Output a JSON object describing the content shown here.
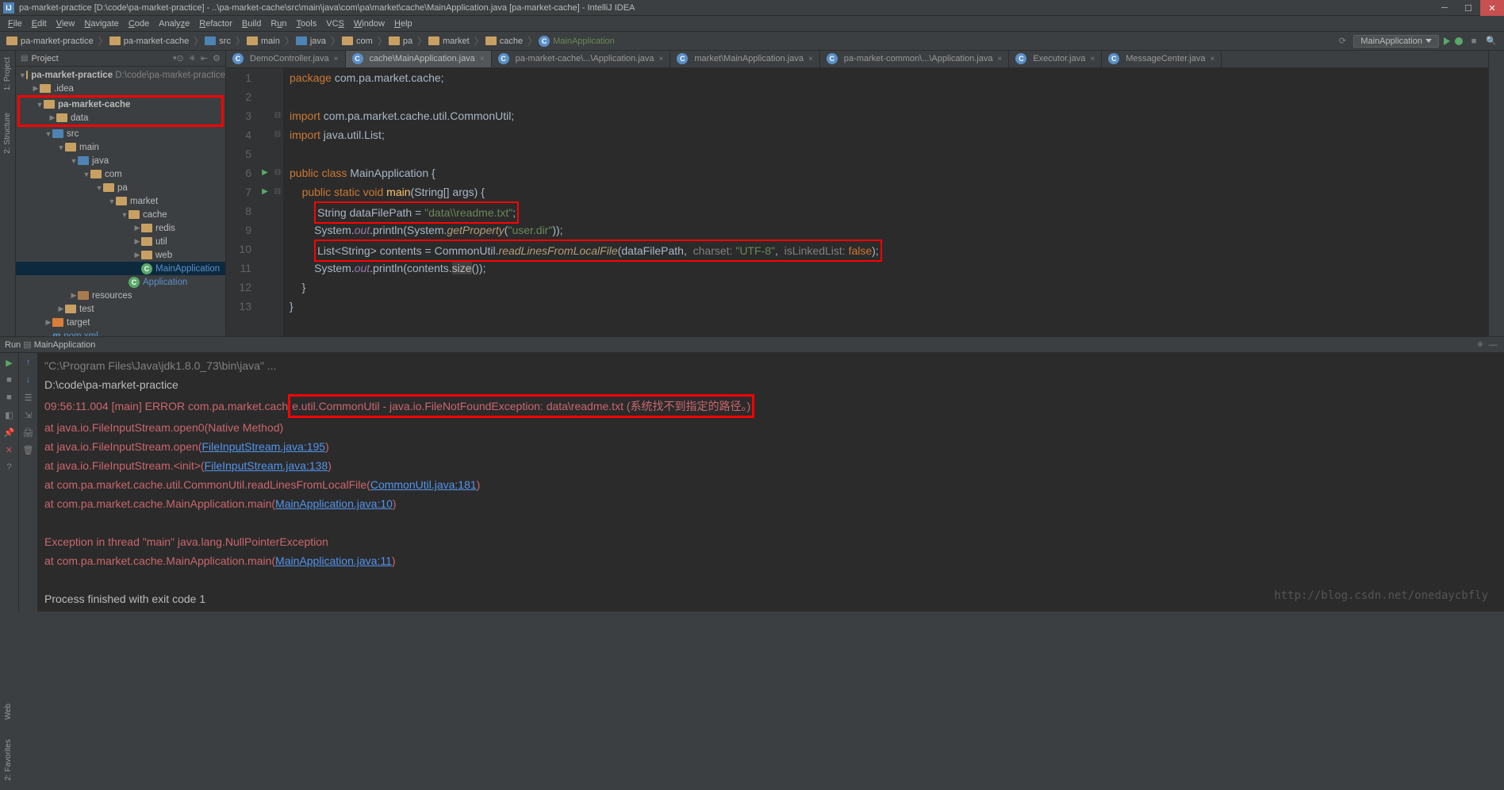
{
  "titlebar": {
    "text": "pa-market-practice [D:\\code\\pa-market-practice] - ..\\pa-market-cache\\src\\main\\java\\com\\pa\\market\\cache\\MainApplication.java [pa-market-cache] - IntelliJ IDEA"
  },
  "menu": [
    "File",
    "Edit",
    "View",
    "Navigate",
    "Code",
    "Analyze",
    "Refactor",
    "Build",
    "Run",
    "Tools",
    "VCS",
    "Window",
    "Help"
  ],
  "breadcrumb": [
    "pa-market-practice",
    "pa-market-cache",
    "src",
    "main",
    "java",
    "com",
    "pa",
    "market",
    "cache",
    "MainApplication"
  ],
  "run_config": "MainApplication",
  "left_tabs": [
    "1: Project",
    "2: Structure"
  ],
  "right_tabs": [],
  "project_panel": {
    "title": "Project"
  },
  "tree": {
    "root": {
      "label": "pa-market-practice",
      "path": "D:\\code\\pa-market-practice"
    },
    "idea": ".idea",
    "cache_mod": "pa-market-cache",
    "data": "data",
    "src": "src",
    "main": "main",
    "java": "java",
    "com": "com",
    "pa": "pa",
    "market": "market",
    "cache": "cache",
    "redis": "redis",
    "util": "util",
    "web": "web",
    "main_app": "MainApplication",
    "application": "Application",
    "resources": "resources",
    "test": "test",
    "target": "target",
    "pom": "pom.xml"
  },
  "editor_tabs": [
    {
      "label": "DemoController.java",
      "active": false
    },
    {
      "label": "cache\\MainApplication.java",
      "active": true
    },
    {
      "label": "pa-market-cache\\...\\Application.java",
      "active": false
    },
    {
      "label": "market\\MainApplication.java",
      "active": false
    },
    {
      "label": "pa-market-common\\...\\Application.java",
      "active": false
    },
    {
      "label": "Executor.java",
      "active": false
    },
    {
      "label": "MessageCenter.java",
      "active": false
    }
  ],
  "code": {
    "line_count": 13,
    "package": "package com.pa.market.cache;",
    "import1": "import com.pa.market.cache.util.CommonUtil;",
    "import2": "import java.util.List;",
    "l8_a": "String dataFilePath = ",
    "l8_b": "\"data\\\\readme.txt\"",
    "l8_c": ";",
    "l9": "System.out.println(System.getProperty(\"user.dir\"));",
    "l10_a": "List<String> contents = CommonUtil.",
    "l10_fn": "readLinesFromLocalFile",
    "l10_b": "(dataFilePath,  charset: ",
    "l10_c": "\"UTF-8\"",
    "l10_d": ",  isLinkedList: ",
    "l10_e": "false",
    "l10_f": ");",
    "l11": "System.out.println(contents.size());"
  },
  "run": {
    "title": "Run",
    "config": "MainApplication",
    "lines": {
      "cmd": "\"C:\\Program Files\\Java\\jdk1.8.0_73\\bin\\java\" ...",
      "cwd": "D:\\code\\pa-market-practice",
      "err": "09:56:11.004 [main] ERROR com.pa.market.cache.util.CommonUtil - java.io.FileNotFoundException: data\\readme.txt (系统找不到指定的路径。)",
      "at1": "    at java.io.FileInputStream.open0(Native Method)",
      "at2_a": "    at java.io.FileInputStream.open(",
      "at2_l": "FileInputStream.java:195",
      "at3_a": "    at java.io.FileInputStream.<init>(",
      "at3_l": "FileInputStream.java:138",
      "at4_a": "    at com.pa.market.cache.util.CommonUtil.readLinesFromLocalFile(",
      "at4_l": "CommonUtil.java:181",
      "at5_a": "    at com.pa.market.cache.MainApplication.main(",
      "at5_l": "MainApplication.java:10",
      "ex2": "Exception in thread \"main\" java.lang.NullPointerException",
      "at6_a": "    at com.pa.market.cache.MainApplication.main(",
      "at6_l": "MainApplication.java:11",
      "exit": "Process finished with exit code 1"
    }
  },
  "watermark": "http://blog.csdn.net/onedaycbfly",
  "bottom_tabs": [
    "Web",
    "2: Favorites"
  ]
}
